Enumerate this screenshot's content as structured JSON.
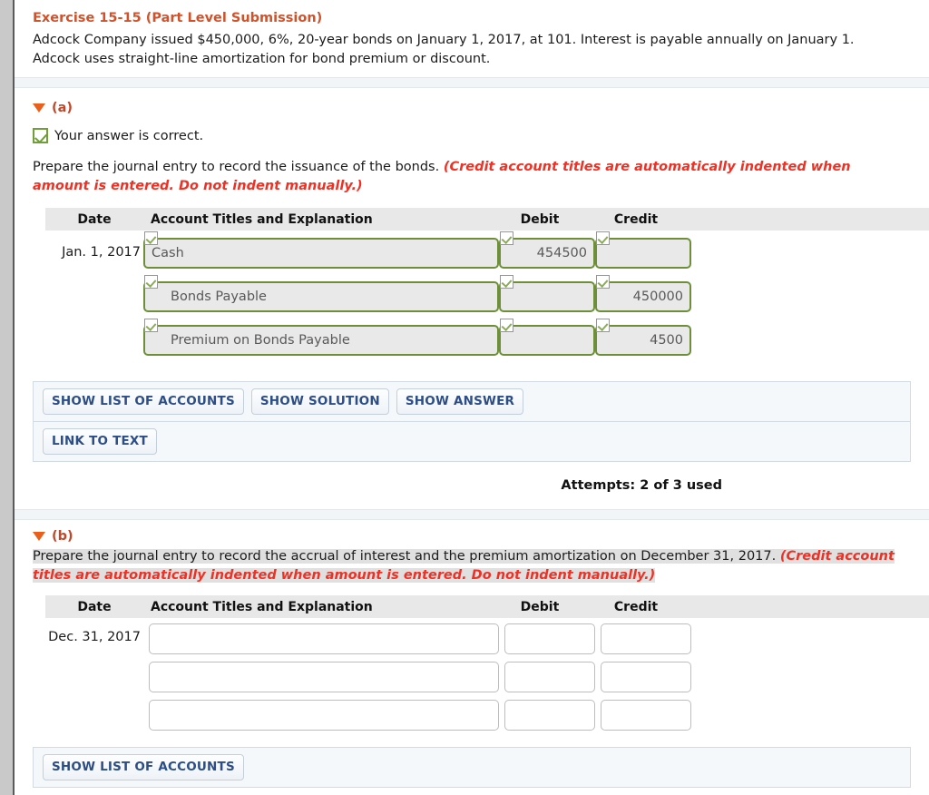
{
  "exercise": {
    "title": "Exercise 15-15 (Part Level Submission)",
    "body": "Adcock Company issued $450,000, 6%, 20-year bonds on January 1, 2017, at 101. Interest is payable annually on January 1. Adcock uses straight-line amortization for bond premium or discount."
  },
  "part_a": {
    "label": "(a)",
    "status_text": "Your answer is correct.",
    "instruction_plain": "Prepare the journal entry to record the issuance of the bonds. ",
    "instruction_emphasis": "(Credit account titles are automatically indented when amount is entered. Do not indent manually.)",
    "table": {
      "headers": {
        "date": "Date",
        "account": "Account Titles and Explanation",
        "debit": "Debit",
        "credit": "Credit"
      },
      "rows": [
        {
          "date": "Jan. 1, 2017",
          "account": "Cash",
          "debit": "454500",
          "credit": "",
          "indent": false
        },
        {
          "date": "",
          "account": "Bonds Payable",
          "debit": "",
          "credit": "450000",
          "indent": true
        },
        {
          "date": "",
          "account": "Premium on Bonds Payable",
          "debit": "",
          "credit": "4500",
          "indent": true
        }
      ]
    },
    "buttons_row1": [
      "SHOW LIST OF ACCOUNTS",
      "SHOW SOLUTION",
      "SHOW ANSWER"
    ],
    "buttons_row2": [
      "LINK TO TEXT"
    ],
    "attempts": "Attempts: 2 of 3 used"
  },
  "part_b": {
    "label": "(b)",
    "instruction_plain": "Prepare the journal entry to record the accrual of interest and the premium amortization on December 31, 2017. ",
    "instruction_emphasis": "(Credit account titles are automatically indented when amount is entered. Do not indent manually.)",
    "table": {
      "headers": {
        "date": "Date",
        "account": "Account Titles and Explanation",
        "debit": "Debit",
        "credit": "Credit"
      },
      "rows": [
        {
          "date": "Dec. 31, 2017",
          "account": "",
          "debit": "",
          "credit": ""
        },
        {
          "date": "",
          "account": "",
          "debit": "",
          "credit": ""
        },
        {
          "date": "",
          "account": "",
          "debit": "",
          "credit": ""
        }
      ]
    },
    "buttons_row1": [
      "SHOW LIST OF ACCOUNTS"
    ]
  },
  "colors": {
    "title_orange": "#d0522b",
    "emphasis_red": "#ee3124",
    "answer_green": "#6d8f39",
    "button_blue": "#2c4d85"
  }
}
